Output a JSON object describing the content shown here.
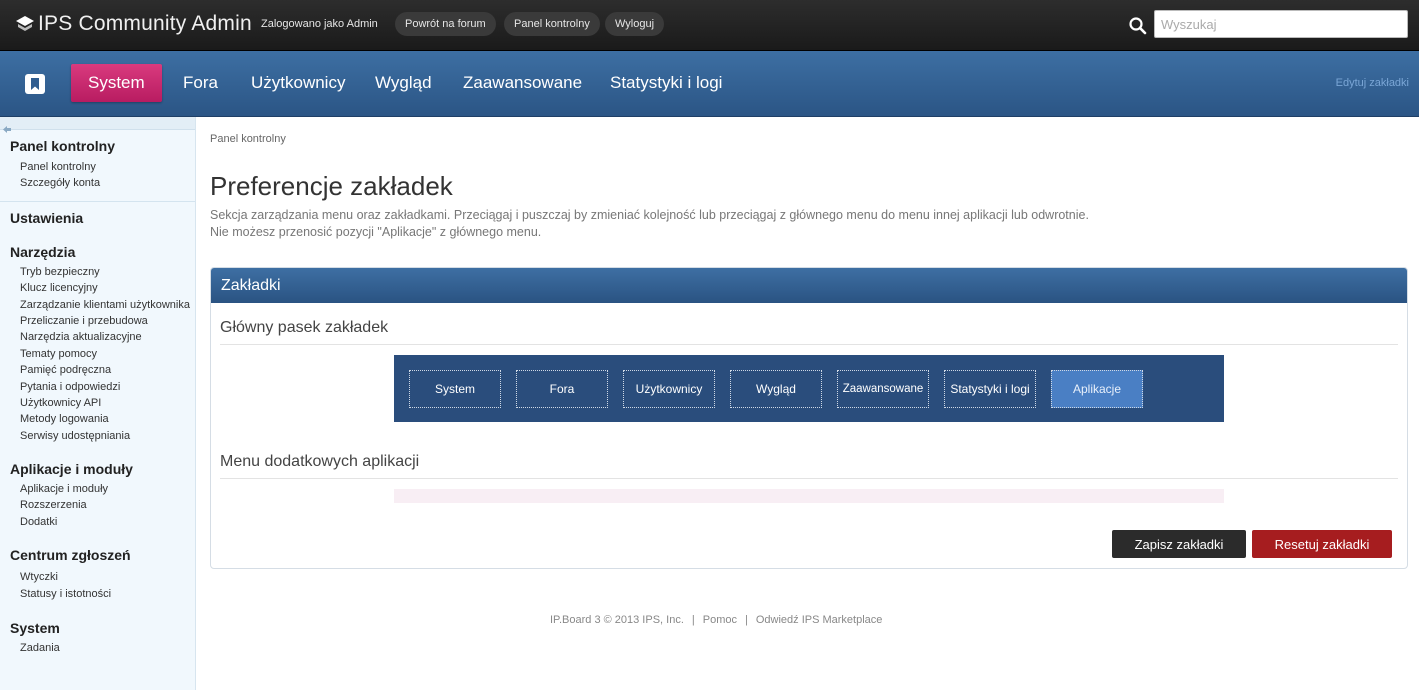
{
  "app": {
    "title": "IPS Community Admin",
    "logged_in": "Zalogowano jako Admin",
    "top_links": [
      "Powrót na forum",
      "Panel kontrolny",
      "Wyloguj"
    ],
    "search_placeholder": "Wyszukaj"
  },
  "nav": {
    "tabs": [
      "System",
      "Fora",
      "Użytkownicy",
      "Wygląd",
      "Zaawansowane",
      "Statystyki i logi"
    ],
    "active": "System",
    "edit_label": "Edytuj zakładki"
  },
  "sidebar": {
    "sections": [
      {
        "title": "Panel kontrolny",
        "items": [
          "Panel kontrolny",
          "Szczegóły konta"
        ]
      },
      {
        "title": "Ustawienia",
        "items": []
      },
      {
        "title": "Narzędzia",
        "items": [
          "Tryb bezpieczny",
          "Klucz licencyjny",
          "Zarządzanie klientami użytkownika",
          "Przeliczanie i przebudowa",
          "Narzędzia aktualizacyjne",
          "Tematy pomocy",
          "Pamięć podręczna",
          "Pytania i odpowiedzi",
          "Użytkownicy API",
          "Metody logowania",
          "Serwisy udostępniania"
        ]
      },
      {
        "title": "Aplikacje i moduły",
        "items": [
          "Aplikacje i moduły",
          "Rozszerzenia",
          "Dodatki"
        ]
      },
      {
        "title": "Centrum zgłoszeń",
        "items": [
          "Wtyczki",
          "Statusy i istotności"
        ]
      },
      {
        "title": "System",
        "items": [
          "Zadania"
        ]
      }
    ]
  },
  "main": {
    "breadcrumb": "Panel kontrolny",
    "title": "Preferencje zakładek",
    "description_line1": "Sekcja zarządzania menu oraz zakładkami. Przeciągaj i puszczaj by zmieniać kolejność lub przeciągaj z głównego menu do menu innej aplikacji lub odwrotnie.",
    "description_line2": "Nie możesz przenosić pozycji \"Aplikacje\" z głównego menu.",
    "panel_title": "Zakładki",
    "main_bar_title": "Główny pasek zakładek",
    "main_bar_tabs": [
      "System",
      "Fora",
      "Użytkownicy",
      "Wygląd",
      "Zaawansowane",
      "Statystyki i logi",
      "Aplikacje"
    ],
    "apps_menu_title": "Menu dodatkowych aplikacji",
    "save_label": "Zapisz zakładki",
    "reset_label": "Resetuj zakładki"
  },
  "footer": {
    "copyright": "IP.Board 3 © 2013 IPS, Inc.",
    "links": [
      "Pomoc",
      "Odwiedź IPS Marketplace"
    ]
  },
  "colors": {
    "accent_active_tab": "#c92a6f",
    "nav_blue": "#2f5d90",
    "save_button": "#2b2b2b",
    "reset_button": "#a61d1f"
  }
}
